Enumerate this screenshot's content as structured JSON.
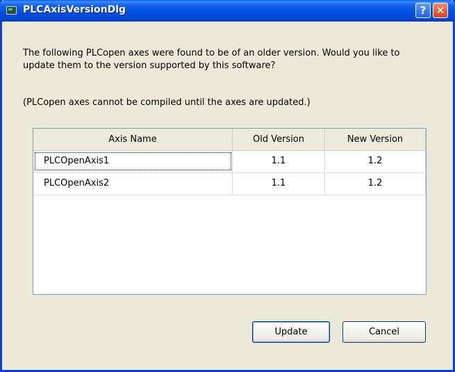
{
  "window": {
    "title": "PLCAxisVersionDlg",
    "help_glyph": "?",
    "close_glyph": "✕"
  },
  "message": {
    "line1": "The following PLCopen axes were found to be of an older version. Would you like to update them to the version supported by this software?",
    "line2": "(PLCopen axes cannot be compiled until the axes are updated.)"
  },
  "table": {
    "columns": [
      "Axis Name",
      "Old Version",
      "New Version"
    ],
    "rows": [
      {
        "name": "PLCOpenAxis1",
        "old": "1.1",
        "new": "1.2"
      },
      {
        "name": "PLCOpenAxis2",
        "old": "1.1",
        "new": "1.2"
      }
    ]
  },
  "buttons": {
    "update": "Update",
    "cancel": "Cancel"
  }
}
